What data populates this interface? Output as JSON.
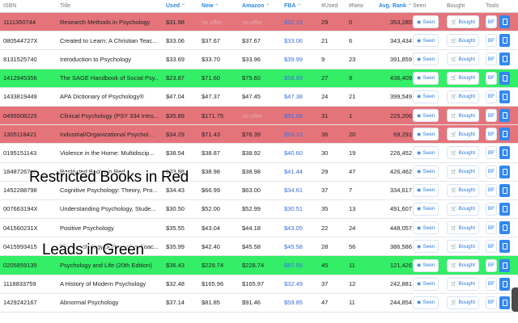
{
  "header": {
    "isbn": "ISBN",
    "title": "Title",
    "used": "Used",
    "new": "New",
    "amazon": "Amazon",
    "fba": "FBA",
    "num_used": "#Used",
    "num_new": "#New",
    "avg_rank": "Avg. Rank",
    "seen": "Seen",
    "bought": "Bought",
    "tools": "Tools",
    "sort_glyph": "⌃"
  },
  "buttons": {
    "seen": "Seen",
    "bought": "Bought",
    "bf": "BF"
  },
  "rows": [
    {
      "status": "red",
      "isbn": "1111350744",
      "title": "Research Methods in Psychology",
      "used": "$31.98",
      "new": "no offer",
      "amazon": "no offer",
      "fba": "$32.15",
      "num_used": "29",
      "num_new": "0",
      "rank": "353,285"
    },
    {
      "status": "",
      "isbn": "080544727X",
      "title": "Created to Learn: A Christian Teac...",
      "used": "$33.06",
      "new": "$37.67",
      "amazon": "$37.67",
      "fba": "$33.06",
      "num_used": "21",
      "num_new": "6",
      "rank": "343,434"
    },
    {
      "status": "",
      "isbn": "8131525740",
      "title": "Introduction to Psychology",
      "used": "$33.69",
      "new": "$33.70",
      "amazon": "$33.96",
      "fba": "$39.99",
      "num_used": "9",
      "num_new": "23",
      "rank": "391,859"
    },
    {
      "status": "green",
      "isbn": "1412945356",
      "title": "The SAGE Handbook of Social Psy...",
      "used": "$23.87",
      "new": "$71.60",
      "amazon": "$75.60",
      "fba": "$58.99",
      "num_used": "27",
      "num_new": "9",
      "rank": "436,409"
    },
    {
      "status": "",
      "isbn": "1433819449",
      "title": "APA Dictionary of Psychology®",
      "used": "$47.04",
      "new": "$47.37",
      "amazon": "$47.45",
      "fba": "$47.38",
      "num_used": "24",
      "num_new": "21",
      "rank": "399,549"
    },
    {
      "status": "red",
      "isbn": "0495508225",
      "title": "Clinical Psychology (PSY 334 Intro...",
      "used": "$35.89",
      "new": "$171.75",
      "amazon": "no offer",
      "fba": "$51.08",
      "num_used": "31",
      "num_new": "1",
      "rank": "225,206"
    },
    {
      "status": "red",
      "isbn": "1305118421",
      "title": "Industrial/Organizational Psychol...",
      "used": "$34.29",
      "new": "$71.43",
      "amazon": "$76.39",
      "fba": "$59.10",
      "num_used": "36",
      "num_new": "20",
      "rank": "69,291"
    },
    {
      "status": "",
      "isbn": "0195151143",
      "title": "Violence in the Home: Multidiscip...",
      "used": "$38.54",
      "new": "$38.87",
      "amazon": "$38.92",
      "fba": "$40.60",
      "num_used": "30",
      "num_new": "19",
      "rank": "226,452"
    },
    {
      "status": "",
      "isbn": "184872673X",
      "title": "Restricted Books in Red",
      "used": "$33.88",
      "new": "$38.98",
      "amazon": "$38.98",
      "fba": "$41.44",
      "num_used": "29",
      "num_new": "47",
      "rank": "426,462"
    },
    {
      "status": "",
      "isbn": "1452288798",
      "title": "Cognitive Psychology: Theory, Pro...",
      "used": "$34.43",
      "new": "$66.99",
      "amazon": "$63.00",
      "fba": "$34.61",
      "num_used": "37",
      "num_new": "7",
      "rank": "334,617"
    },
    {
      "status": "",
      "isbn": "007663194X",
      "title": "Understanding Psychology, Stude...",
      "used": "$30.50",
      "new": "$52.00",
      "amazon": "$52.99",
      "fba": "$30.51",
      "num_used": "35",
      "num_new": "13",
      "rank": "491,607"
    },
    {
      "status": "",
      "isbn": "041560231X",
      "title": "Positive Psychology",
      "used": "$35.55",
      "new": "$43.04",
      "amazon": "$44.18",
      "fba": "$43.05",
      "num_used": "22",
      "num_new": "24",
      "rank": "448,057"
    },
    {
      "status": "",
      "isbn": "0415993415",
      "title": "The Psychology of Executive Coac...",
      "used": "$35.99",
      "new": "$42.40",
      "amazon": "$45.58",
      "fba": "$45.58",
      "num_used": "28",
      "num_new": "56",
      "rank": "386,586"
    },
    {
      "status": "green",
      "isbn": "0205859135",
      "title": "Psychology and Life (20th Edition)",
      "used": "$36.43",
      "new": "$229.74",
      "amazon": "$228.74",
      "fba": "$87.55",
      "num_used": "45",
      "num_new": "11",
      "rank": "121,426"
    },
    {
      "status": "",
      "isbn": "1118833759",
      "title": "A History of Modern Psychology",
      "used": "$32.48",
      "new": "$165.96",
      "amazon": "$165.97",
      "fba": "$32.49",
      "num_used": "37",
      "num_new": "12",
      "rank": "242,881"
    },
    {
      "status": "",
      "isbn": "1429242167",
      "title": "Abnormal Psychology",
      "used": "$37.14",
      "new": "$81.85",
      "amazon": "$91.46",
      "fba": "$59.85",
      "num_used": "47",
      "num_new": "11",
      "rank": "244,854"
    }
  ],
  "overlays": {
    "restricted": "Restricted Books in Red",
    "leads": "Leads in Green"
  },
  "colors": {
    "restricted_row": "#e5747a",
    "lead_row": "#33ee66",
    "accent": "#2b8ae0"
  }
}
